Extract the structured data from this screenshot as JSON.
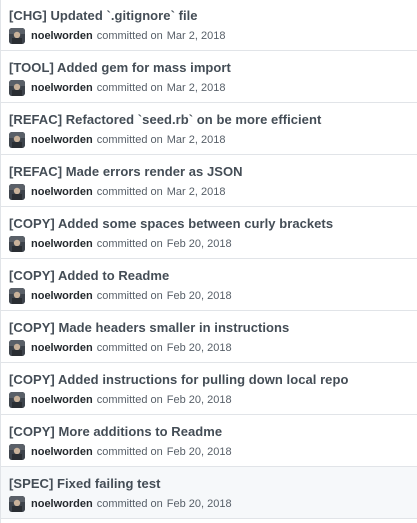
{
  "commits": [
    {
      "title": "[CHG] Updated `.gitignore` file",
      "author": "noelworden",
      "verb": "committed on",
      "date": "Mar 2, 2018"
    },
    {
      "title": "[TOOL] Added gem for mass import",
      "author": "noelworden",
      "verb": "committed on",
      "date": "Mar 2, 2018"
    },
    {
      "title": "[REFAC] Refactored `seed.rb` on be more efficient",
      "author": "noelworden",
      "verb": "committed on",
      "date": "Mar 2, 2018"
    },
    {
      "title": "[REFAC] Made errors render as JSON",
      "author": "noelworden",
      "verb": "committed on",
      "date": "Mar 2, 2018"
    },
    {
      "title": "[COPY] Added some spaces between curly brackets",
      "author": "noelworden",
      "verb": "committed on",
      "date": "Feb 20, 2018"
    },
    {
      "title": "[COPY] Added to Readme",
      "author": "noelworden",
      "verb": "committed on",
      "date": "Feb 20, 2018"
    },
    {
      "title": "[COPY] Made headers smaller in instructions",
      "author": "noelworden",
      "verb": "committed on",
      "date": "Feb 20, 2018"
    },
    {
      "title": "[COPY] Added instructions for pulling down local repo",
      "author": "noelworden",
      "verb": "committed on",
      "date": "Feb 20, 2018"
    },
    {
      "title": "[COPY] More additions to Readme",
      "author": "noelworden",
      "verb": "committed on",
      "date": "Feb 20, 2018"
    },
    {
      "title": "[SPEC] Fixed failing test",
      "author": "noelworden",
      "verb": "committed on",
      "date": "Feb 20, 2018"
    }
  ],
  "highlighted_index": 9,
  "colors": {
    "title": "#444d56",
    "author": "#24292e",
    "meta": "#586069",
    "border": "#e1e4e8",
    "highlight_bg": "#f6f8fa"
  },
  "icons": {
    "avatar": "user-avatar-icon"
  }
}
